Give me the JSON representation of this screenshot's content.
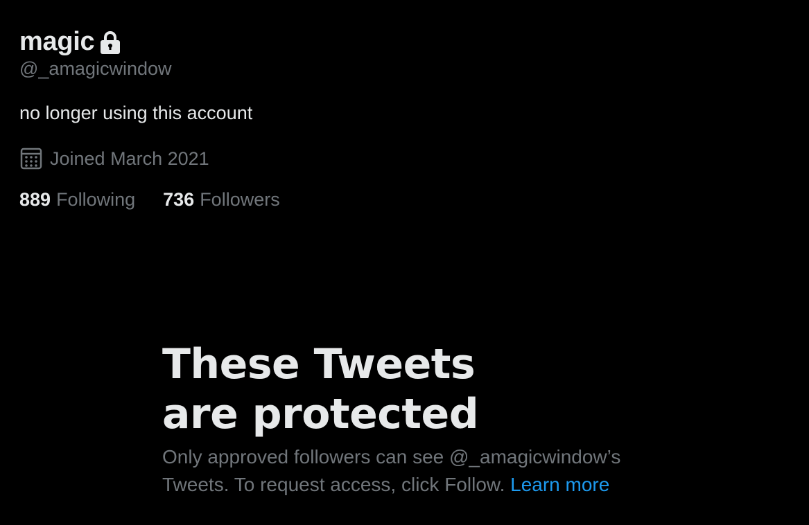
{
  "profile": {
    "display_name": "magic",
    "lock_icon": "lock-icon",
    "handle": "@_amagicwindow",
    "bio": "no longer using this account",
    "calendar_icon": "calendar-icon",
    "joined": "Joined March 2021",
    "following_count": "889",
    "following_label": "Following",
    "followers_count": "736",
    "followers_label": "Followers"
  },
  "protected": {
    "title": "These Tweets are protected",
    "description": "Only approved followers can see @_amagicwindow’s Tweets. To request access, click Follow.",
    "learn_more": "Learn more"
  },
  "colors": {
    "background": "#000000",
    "primary_text": "#e7e9ea",
    "secondary_text": "#71767b",
    "link": "#1d9bf0"
  }
}
